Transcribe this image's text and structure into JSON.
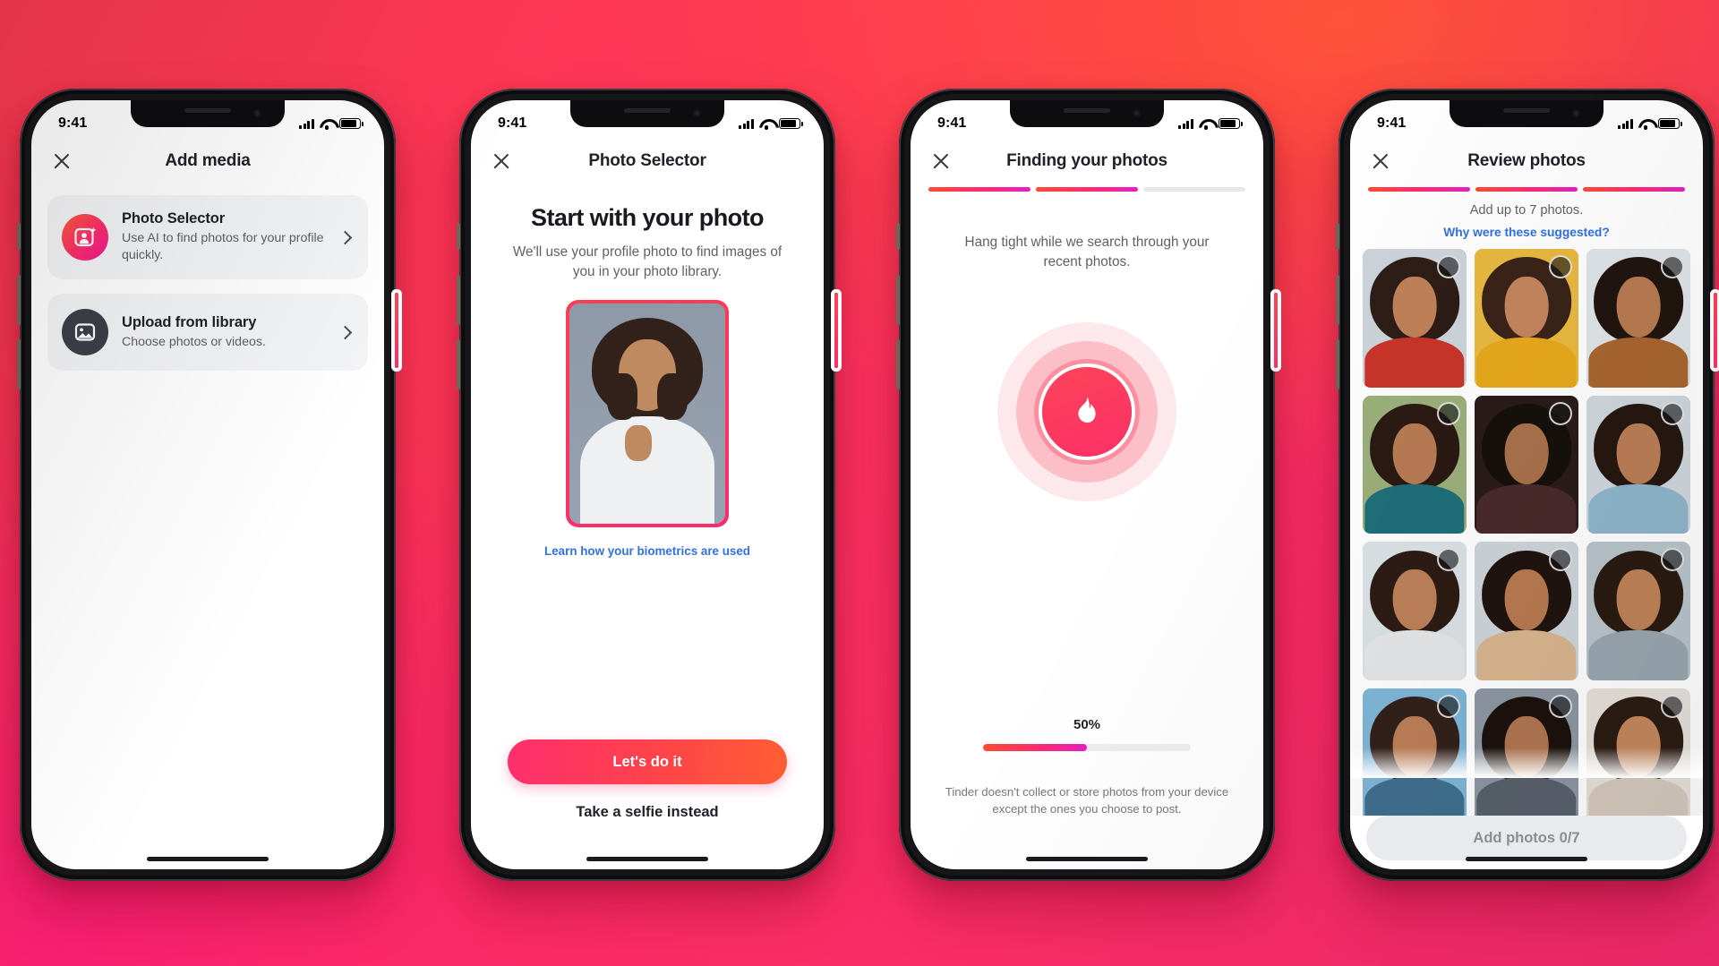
{
  "background": {
    "top_right": "#ff5238",
    "bottom_left": "#fa1f72",
    "base": "#fd3558"
  },
  "accent": {
    "pink": "#fd2e6e",
    "orange": "#ff5e34",
    "magenta": "#e420c4",
    "link_blue": "#2f72e0"
  },
  "status_bar": {
    "time": "9:41",
    "signal_icon": "signal-bars-icon",
    "wifi_icon": "wifi-icon",
    "battery_icon": "battery-icon"
  },
  "phones": [
    {
      "id": "add-media",
      "nav_title": "Add media",
      "close_icon": "close-icon",
      "has_steps": false,
      "options": [
        {
          "icon": "photo-selector-ai-icon",
          "icon_style": "gradient",
          "title": "Photo Selector",
          "subtitle": "Use AI to find photos for your profile quickly.",
          "chevron": "chevron-right-icon"
        },
        {
          "icon": "image-library-icon",
          "icon_style": "dark",
          "title": "Upload from library",
          "subtitle": "Choose photos or videos.",
          "chevron": "chevron-right-icon"
        }
      ]
    },
    {
      "id": "photo-selector",
      "nav_title": "Photo Selector",
      "close_icon": "close-icon",
      "has_steps": false,
      "heading": "Start with your photo",
      "subtitle": "We'll use your profile photo to find images of you in your photo library.",
      "biometrics_link": "Learn how your biometrics are used",
      "primary_button": "Let's do it",
      "secondary_button": "Take a selfie instead"
    },
    {
      "id": "finding-your-photos",
      "nav_title": "Finding your photos",
      "close_icon": "close-icon",
      "has_steps": true,
      "steps_total": 3,
      "steps_done": 2,
      "subtitle": "Hang tight while we search through your recent photos.",
      "spinner_icon": "tinder-flame-icon",
      "progress_label": "50%",
      "progress_percent": 50,
      "footer": "Tinder doesn't collect or store photos from your device except the ones you choose to post."
    },
    {
      "id": "review-photos",
      "nav_title": "Review photos",
      "close_icon": "close-icon",
      "has_steps": true,
      "steps_total": 3,
      "steps_done": 3,
      "subtitle": "Add up to 7 photos.",
      "suggested_link": "Why were these suggested?",
      "checkbox_icon": "unchecked-circle-icon",
      "selected_count": 0,
      "max_photos": 7,
      "add_button": "Add photos 0/7",
      "add_button_enabled": false,
      "thumbnails": [
        {
          "label": "photo-1",
          "bg": "#ccd3da",
          "outfit": "#c9352a",
          "hair": "#2e1d16",
          "skin": "#c08158"
        },
        {
          "label": "photo-2",
          "bg": "#e8b93f",
          "outfit": "#e8a81c",
          "hair": "#3a2419",
          "skin": "#c4855c"
        },
        {
          "label": "photo-3",
          "bg": "#dfe4e8",
          "outfit": "#a9662f",
          "hair": "#20150f",
          "skin": "#b97b52"
        },
        {
          "label": "photo-4",
          "bg": "#9cb07a",
          "outfit": "#1f6f7a",
          "hair": "#2b1a13",
          "skin": "#b87c54"
        },
        {
          "label": "photo-5",
          "bg": "#2a1c1a",
          "outfit": "#4a2a2c",
          "hair": "#17100c",
          "skin": "#a9714c"
        },
        {
          "label": "photo-6",
          "bg": "#cfd7dd",
          "outfit": "#8fb6cc",
          "hair": "#261811",
          "skin": "#bb7e56"
        },
        {
          "label": "photo-7",
          "bg": "#dbe2e6",
          "outfit": "#e4e6e8",
          "hair": "#2c1c14",
          "skin": "#bd8159"
        },
        {
          "label": "photo-8",
          "bg": "#cdd5da",
          "outfit": "#d8b58e",
          "hair": "#1f140e",
          "skin": "#b87a50"
        },
        {
          "label": "photo-9",
          "bg": "#b9c4cb",
          "outfit": "#9aa7b0",
          "hair": "#2a1a12",
          "skin": "#bf8359"
        },
        {
          "label": "photo-10",
          "bg": "#7fb6d8",
          "outfit": "#3f6f8e",
          "hair": "#33201a",
          "skin": "#bc7f57"
        },
        {
          "label": "photo-11",
          "bg": "#8d97a3",
          "outfit": "#59616c",
          "hair": "#1c120d",
          "skin": "#b07550"
        },
        {
          "label": "photo-12",
          "bg": "#e6e0da",
          "outfit": "#d5c9bd",
          "hair": "#2b1b13",
          "skin": "#c4885e"
        }
      ]
    }
  ]
}
